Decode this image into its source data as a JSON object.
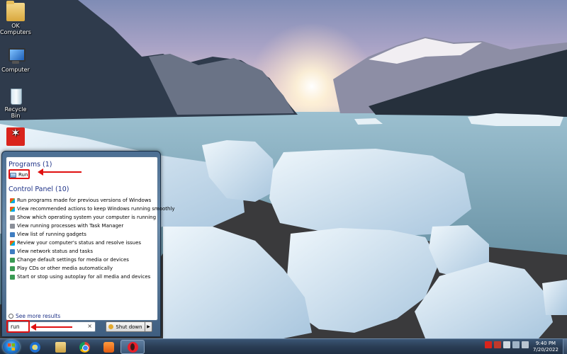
{
  "desktop": {
    "icons": [
      {
        "label": "OK Computers",
        "icon": "folder-icon"
      },
      {
        "label": "Computer",
        "icon": "computer-icon"
      },
      {
        "label": "Recycle Bin",
        "icon": "recycle-bin-icon"
      },
      {
        "label": "",
        "icon": "pdf-reader-icon"
      }
    ]
  },
  "start_menu": {
    "programs_header": "Programs (1)",
    "programs": [
      {
        "label": "Run",
        "icon": "run-icon"
      }
    ],
    "control_panel_header": "Control Panel (10)",
    "control_panel_items": [
      {
        "label": "Run programs made for previous versions of Windows",
        "icon": "flag-icon"
      },
      {
        "label": "View recommended actions to keep Windows running smoothly",
        "icon": "flag-icon"
      },
      {
        "label": "Show which operating system your computer is running",
        "icon": "system-icon"
      },
      {
        "label": "View running processes with Task Manager",
        "icon": "system-icon"
      },
      {
        "label": "View list of running gadgets",
        "icon": "gadgets-icon"
      },
      {
        "label": "Review your computer's status and resolve issues",
        "icon": "flag-icon"
      },
      {
        "label": "View network status and tasks",
        "icon": "network-icon"
      },
      {
        "label": "Change default settings for media or devices",
        "icon": "media-icon"
      },
      {
        "label": "Play CDs or other media automatically",
        "icon": "media-icon"
      },
      {
        "label": "Start or stop using autoplay for all media and devices",
        "icon": "media-icon"
      }
    ],
    "see_more": "See more results",
    "search_value": "run",
    "search_clear": "×",
    "shutdown_label": "Shut down",
    "shutdown_arrow": "▶"
  },
  "taskbar": {
    "pinned": [
      {
        "icon": "internet-explorer-icon",
        "glyph": "e"
      },
      {
        "icon": "file-explorer-icon",
        "glyph": ""
      },
      {
        "icon": "chrome-icon",
        "glyph": ""
      },
      {
        "icon": "media-player-icon",
        "glyph": ""
      },
      {
        "icon": "opera-icon",
        "glyph": ""
      }
    ],
    "clock_time": "9:40 PM",
    "clock_date": "7/20/2022"
  },
  "colors": {
    "annotation": "#e01010",
    "group_header": "#1e3287"
  }
}
